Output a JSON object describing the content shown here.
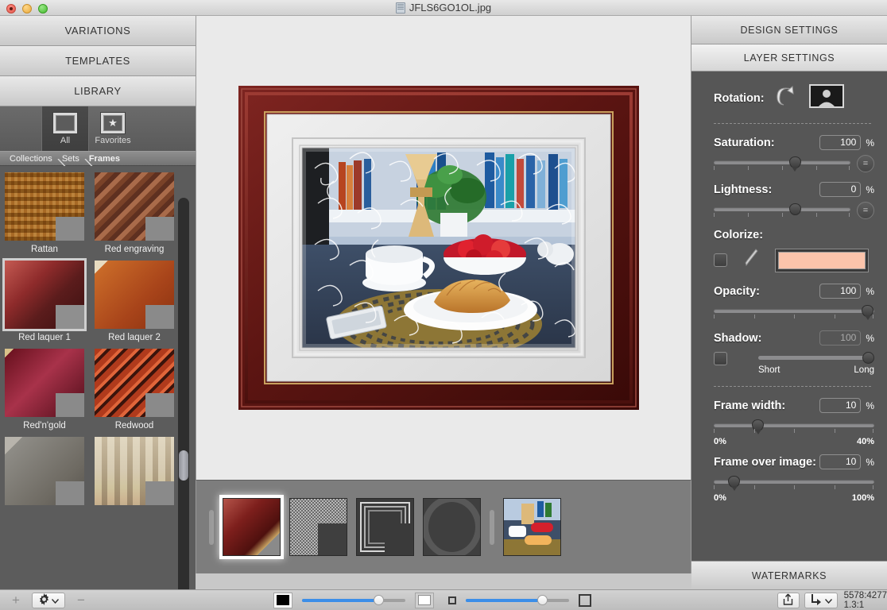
{
  "window": {
    "title": "JFLS6GO1OL.jpg",
    "doc_icon": "document-icon",
    "traffic_lights": [
      "close",
      "minimize",
      "zoom"
    ]
  },
  "left_panel": {
    "accordion": [
      {
        "label": "VARIATIONS"
      },
      {
        "label": "TEMPLATES"
      },
      {
        "label": "LIBRARY"
      }
    ],
    "library_tools": [
      {
        "label": "All",
        "icon": "frame-icon",
        "active": true
      },
      {
        "label": "Favorites",
        "icon": "star-frame-icon",
        "active": false
      }
    ],
    "breadcrumb": [
      "Collections",
      "Sets",
      "Frames"
    ],
    "frames": [
      {
        "label": "Rattan",
        "selected": false,
        "c1": "#c79a52",
        "c2": "#e0c085",
        "c3": "#9d7434"
      },
      {
        "label": "Red engraving",
        "selected": false,
        "c1": "#5e3020",
        "c2": "#a96b4a",
        "c3": "#7a4228"
      },
      {
        "label": "Red laquer 1",
        "selected": true,
        "c1": "#8e2b2b",
        "c2": "#c45a52",
        "c3": "#5b1c1c"
      },
      {
        "label": "Red laquer 2",
        "selected": false,
        "c1": "#a8441a",
        "c2": "#d9803e",
        "c3": "#e8dcc0"
      },
      {
        "label": "Red'n'gold",
        "selected": false,
        "c1": "#6e1422",
        "c2": "#a8324a",
        "c3": "#d9c28a"
      },
      {
        "label": "Redwood",
        "selected": false,
        "c1": "#b03a1c",
        "c2": "#e0653a",
        "c3": "#3a140c"
      },
      {
        "label": "",
        "selected": false,
        "c1": "#8e8c86",
        "c2": "#b8b4ac",
        "c3": "#6e6a62"
      },
      {
        "label": "",
        "selected": false,
        "c1": "#a09686",
        "c2": "#cdc4b2",
        "c3": "#7a7164"
      }
    ]
  },
  "canvas": {
    "artwork_alt": "framed-photo-preview",
    "frame_color_outer": "#6b1a16",
    "frame_color_inner": "#3d0d0b",
    "mat_color": "#e2e2e2"
  },
  "filmstrip": {
    "layers": [
      {
        "name": "frame-layer",
        "selected": true
      },
      {
        "name": "texture-mat-layer",
        "selected": false
      },
      {
        "name": "white-border-layer",
        "selected": false
      },
      {
        "name": "oval-vignette-layer",
        "selected": false
      },
      {
        "name": "photo-layer",
        "selected": false
      }
    ]
  },
  "right_panel": {
    "tabs": [
      {
        "label": "DESIGN SETTINGS",
        "active": false
      },
      {
        "label": "LAYER SETTINGS",
        "active": true
      }
    ],
    "rotation": {
      "label": "Rotation:",
      "rotate_icon": "rotate-ccw-icon",
      "orientation_icon": "landscape-portrait-icon"
    },
    "saturation": {
      "label": "Saturation:",
      "value": "100",
      "unit": "%",
      "position_pct": 50,
      "reset_icon": "equals-icon"
    },
    "lightness": {
      "label": "Lightness:",
      "value": "0",
      "unit": "%",
      "position_pct": 50,
      "reset_icon": "equals-icon"
    },
    "colorize": {
      "label": "Colorize:",
      "enabled": false,
      "eyedropper_icon": "eyedropper-icon",
      "color": "#FBC4AB"
    },
    "opacity": {
      "label": "Opacity:",
      "value": "100",
      "unit": "%",
      "position_pct": 100
    },
    "shadow": {
      "label": "Shadow:",
      "value": "100",
      "unit": "%",
      "enabled": false,
      "min_label": "Short",
      "max_label": "Long",
      "position_pct": 100
    },
    "frame_width": {
      "label": "Frame width:",
      "value": "10",
      "unit": "%",
      "min_label": "0%",
      "max_label": "40%",
      "position_pct": 25
    },
    "frame_over_image": {
      "label": "Frame over image:",
      "value": "10",
      "unit": "%",
      "min_label": "0%",
      "max_label": "100%",
      "position_pct": 10
    },
    "watermarks": {
      "label": "WATERMARKS"
    }
  },
  "bottom_bar": {
    "add_label": "+",
    "gear_icon": "gear-dropdown-icon",
    "remove_label": "−",
    "bg_dark_icon": "black-square-icon",
    "bg_light_icon": "white-square-icon",
    "bg_slider_pct": 72,
    "thumb_small_icon": "small-square-icon",
    "thumb_large_icon": "large-square-icon",
    "thumb_slider_pct": 72,
    "share_icon": "share-icon",
    "export_icon": "export-dropdown-icon",
    "status_line1": "5578:4277",
    "status_line2": "1.3:1"
  }
}
